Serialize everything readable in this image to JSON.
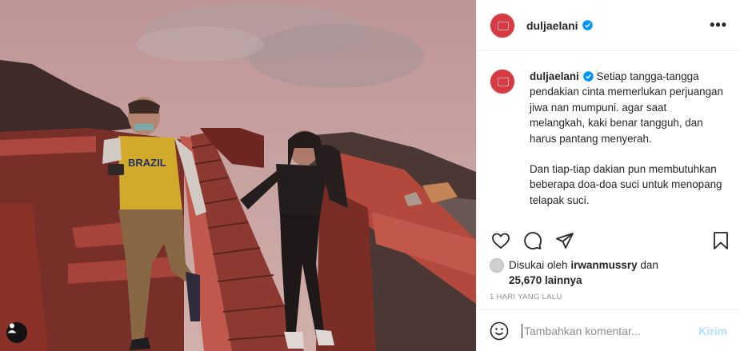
{
  "post": {
    "username": "duljaelani",
    "verified": true,
    "more_icon_text": "•••",
    "caption_paragraphs": [
      "Setiap tangga-tangga pendakian cinta memerlukan perjuangan jiwa nan mumpuni. agar saat melangkah, kaki benar tangguh, dan harus pantang menyerah.",
      "Dan tiap-tiap dakian pun membutuhkan beberapa doa-doa suci untuk menopang telapak suci."
    ],
    "likes": {
      "prefix": "Disukai oleh",
      "user": "irwanmussry",
      "connector": "dan",
      "others": "25,670 lainnya"
    },
    "timestamp": "1 HARI YANG LALU",
    "comment_placeholder": "Tambahkan komentar...",
    "post_button": "Kirim",
    "photo_jacket_text": "BRAZIL"
  },
  "icons": [
    "heart-icon",
    "comment-icon",
    "share-icon",
    "bookmark-icon",
    "emoji-icon",
    "verified-icon",
    "user-tag-icon"
  ],
  "colors": {
    "accent": "#0095f6",
    "post_button": "#b2dffc",
    "avatar": "#d63a43",
    "text": "#262626",
    "muted": "#8e8e8e"
  }
}
